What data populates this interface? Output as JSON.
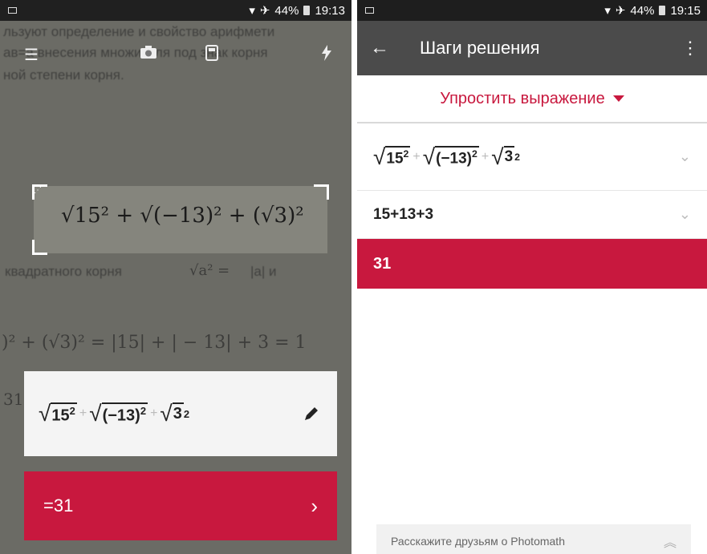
{
  "left": {
    "status": {
      "battery": "44%",
      "time": "19:13"
    },
    "background_lines": [
      "льзуют определение и свойство арифмети",
      "ав=а внесения множителя под знак корня",
      "ной степени корня.",
      "квадратного корня",
      "|a| и"
    ],
    "background_math": [
      "√a² =",
      ")² + (√3)² = |15| + | − 13| + 3 = 1",
      "31"
    ],
    "scanned_expression": "√15² + √(−13)² + (√3)²",
    "result_card": {
      "terms": [
        {
          "base": "15",
          "exp": "2"
        },
        {
          "base": "(−13)",
          "exp": "2"
        },
        {
          "base": "3",
          "exp": "2"
        }
      ]
    },
    "answer": {
      "label": "=31"
    }
  },
  "right": {
    "status": {
      "battery": "44%",
      "time": "19:15"
    },
    "appbar": {
      "title": "Шаги решения"
    },
    "method": {
      "label": "Упростить выражение"
    },
    "steps": [
      {
        "terms": [
          {
            "base": "15",
            "exp": "2"
          },
          {
            "base": "(−13)",
            "exp": "2"
          },
          {
            "base": "3",
            "exp": "2"
          }
        ]
      },
      {
        "text": "15+13+3"
      }
    ],
    "final": {
      "value": "31"
    },
    "share": {
      "label": "Расскажите друзьям о Photomath"
    }
  },
  "colors": {
    "accent": "#c8183e",
    "appbar": "#4b4b4b"
  },
  "icons": [
    "menu-icon",
    "camera-icon",
    "calculator-icon",
    "flash-icon",
    "edit-icon",
    "chevron-right-icon",
    "back-arrow-icon",
    "more-vert-icon",
    "caret-down-icon",
    "chevron-down-icon",
    "chevron-up-icon"
  ]
}
